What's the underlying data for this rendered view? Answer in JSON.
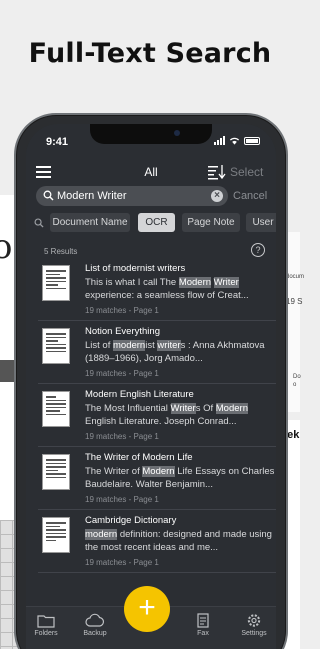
{
  "headline": "Full-Text Search",
  "background": {
    "left_big_text": "o",
    "right_small_lines": [
      "docum",
      "19 S",
      "Do",
      "o",
      "eek"
    ]
  },
  "status_bar": {
    "time": "9:41"
  },
  "topbar": {
    "title": "All",
    "select_label": "Select"
  },
  "search": {
    "value": "Modern Writer",
    "cancel_label": "Cancel"
  },
  "filters": [
    "Document Name",
    "OCR",
    "Page Note",
    "User"
  ],
  "active_filter": "OCR",
  "results_count": "5 Results",
  "results": [
    {
      "title": "List of modernist writers",
      "snippet": [
        [
          "This is what I call The ",
          false
        ],
        [
          "Modern",
          true
        ],
        [
          " ",
          false
        ],
        [
          "Writer",
          true
        ],
        [
          " experience: a seamless flow of Creat...",
          false
        ]
      ],
      "meta": "19 matches - Page 1"
    },
    {
      "title": "Notion Everything",
      "snippet": [
        [
          "List of ",
          false
        ],
        [
          "modern",
          true
        ],
        [
          "ist ",
          false
        ],
        [
          "writer",
          true
        ],
        [
          "s : Anna Akhmatova (1889–1966), Jorg Amado...",
          false
        ]
      ],
      "meta": "19 matches - Page 1"
    },
    {
      "title": "Modern English Literature",
      "snippet": [
        [
          "The Most Influential ",
          false
        ],
        [
          "Writer",
          true
        ],
        [
          "s Of ",
          false
        ],
        [
          "Modern",
          true
        ],
        [
          " English Literature. Joseph Conrad...",
          false
        ]
      ],
      "meta": "19 matches - Page 1"
    },
    {
      "title": "The Writer of Modern Life",
      "snippet": [
        [
          "The Writer of ",
          false
        ],
        [
          "Modern",
          true
        ],
        [
          " Life Essays on Charles Baudelaire. Walter Benjamin...",
          false
        ]
      ],
      "meta": "19 matches - Page 1"
    },
    {
      "title": "Cambridge Dictionary",
      "snippet": [
        [
          "modern",
          true
        ],
        [
          " definition: designed and made using the most recent ideas and me...",
          false
        ]
      ],
      "meta": "19 matches - Page 1"
    }
  ],
  "tabbar": {
    "tabs": [
      {
        "label": "Folders",
        "icon": "folder-icon"
      },
      {
        "label": "Backup",
        "icon": "cloud-icon"
      },
      {
        "label": "Fax",
        "icon": "fax-icon"
      },
      {
        "label": "Settings",
        "icon": "gear-icon"
      }
    ],
    "fab_label": "+"
  },
  "colors": {
    "accent": "#f5c400",
    "screen_bg": "#2b2e33",
    "highlight": "#6b6e73"
  }
}
